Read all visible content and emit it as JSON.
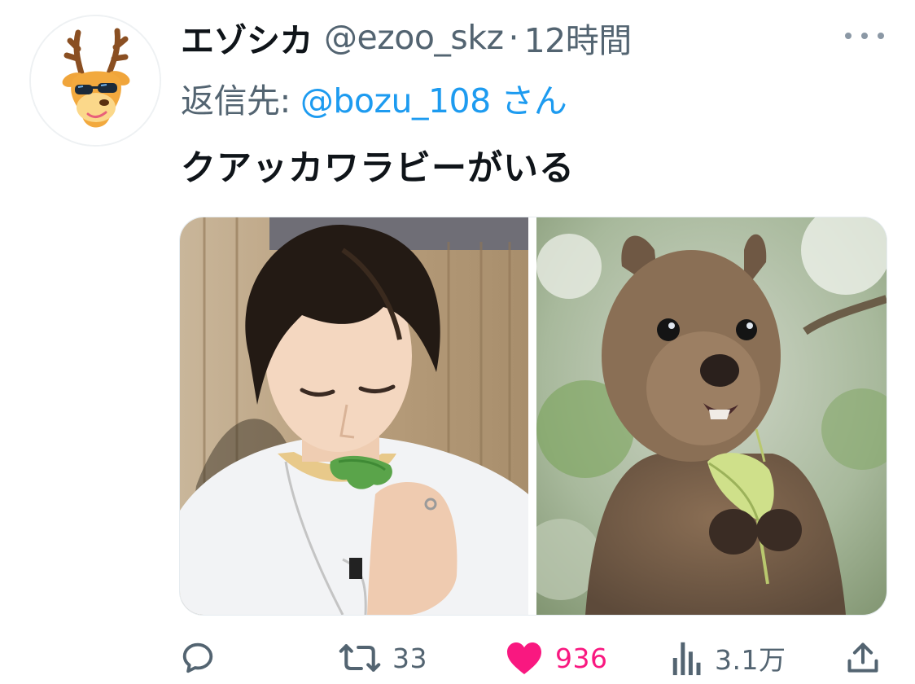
{
  "tweet": {
    "display_name": "エゾシカ",
    "handle": "@ezoo_skz",
    "separator": "·",
    "time": "12時間",
    "reply_prefix": "返信先:",
    "reply_to": "@bozu_108 さん",
    "text": "クアッカワラビーがいる",
    "media": [
      {
        "icon": "person-eating-lettuce-photo"
      },
      {
        "icon": "quokka-eating-leaf-photo"
      }
    ]
  },
  "actions": {
    "reply": {
      "icon": "reply-icon",
      "count": ""
    },
    "retweet": {
      "icon": "retweet-icon",
      "count": "33"
    },
    "like": {
      "icon": "heart-icon",
      "count": "936",
      "liked": true
    },
    "views": {
      "icon": "views-icon",
      "count": "3.1万"
    },
    "share": {
      "icon": "share-icon",
      "count": ""
    }
  },
  "colors": {
    "text": "#0f1419",
    "secondary": "#536471",
    "link": "#1d9bf0",
    "like": "#f91880"
  }
}
